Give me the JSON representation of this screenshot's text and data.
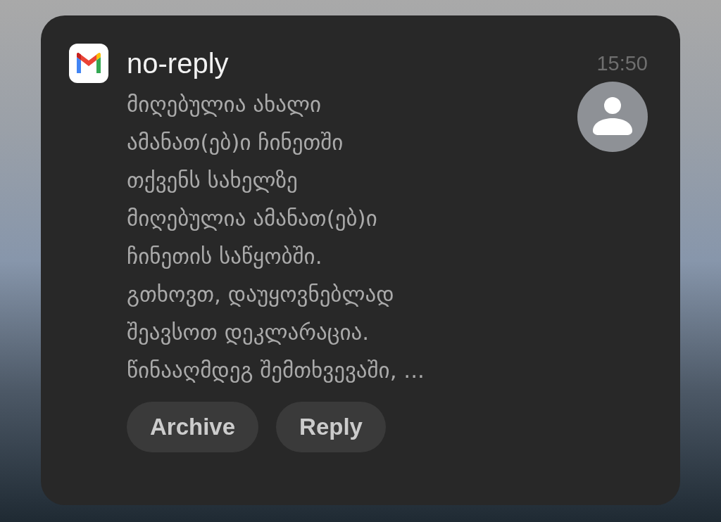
{
  "notification": {
    "sender": "no-reply",
    "time": "15:50",
    "lines": [
      "მიღებულია ახალი",
      "ამანათ(ებ)ი ჩინეთში",
      "თქვენს სახელზე",
      "მიღებულია ამანათ(ებ)ი",
      "ჩინეთის საწყობში.",
      "გთხოვთ, დაუყოვნებლად",
      "შეავსოთ დეკლარაცია.",
      "წინააღმდეგ შემთხვევაში, ..."
    ],
    "actions": [
      "Archive",
      "Reply"
    ]
  }
}
